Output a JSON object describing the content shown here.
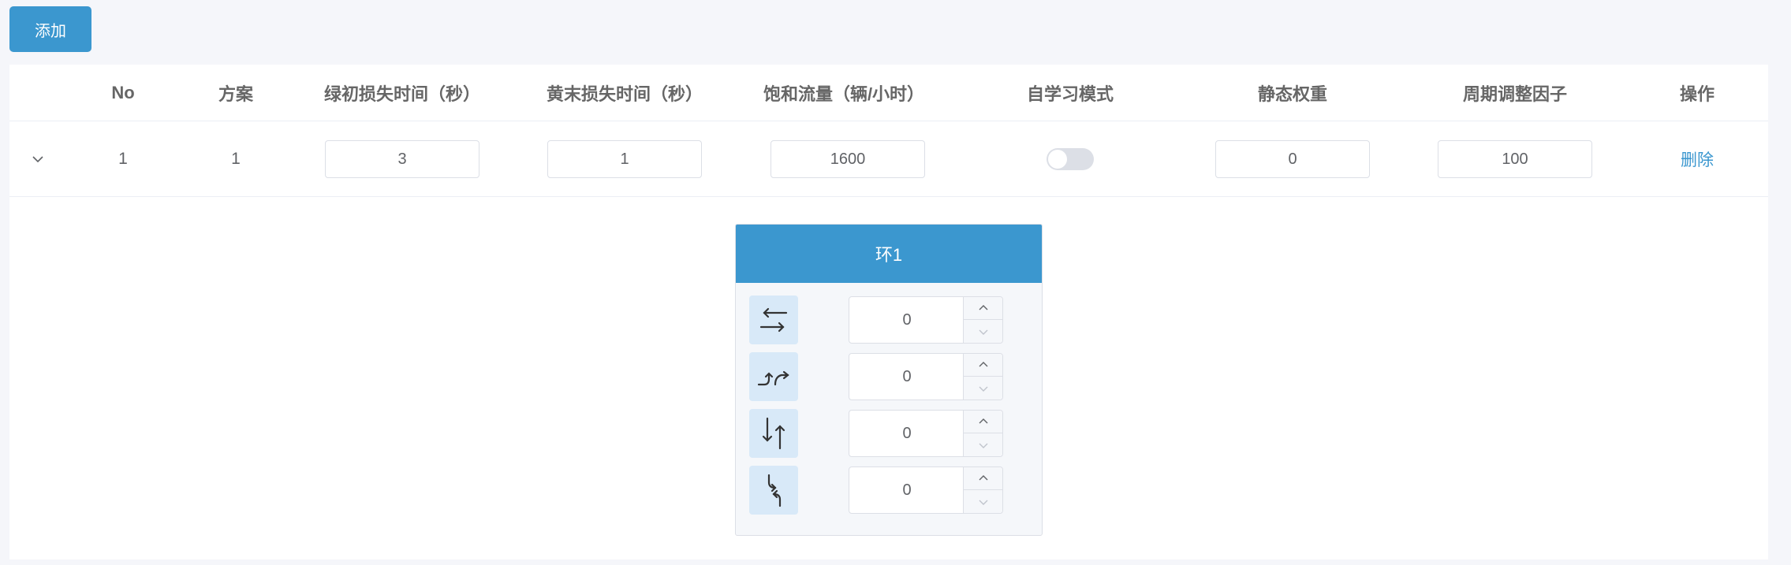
{
  "toolbar": {
    "add_label": "添加"
  },
  "table": {
    "headers": [
      "No",
      "方案",
      "绿初损失时间（秒）",
      "黄末损失时间（秒）",
      "饱和流量（辆/小时）",
      "自学习模式",
      "静态权重",
      "周期调整因子",
      "操作"
    ],
    "rows": [
      {
        "no": "1",
        "plan": "1",
        "green_loss": "3",
        "yellow_loss": "1",
        "saturation_flow": "1600",
        "self_learning": false,
        "static_weight": "0",
        "cycle_factor": "100",
        "action": "删除"
      }
    ]
  },
  "ring": {
    "title": "环1",
    "phases": [
      {
        "icon": "straight-through-icon",
        "value": "0"
      },
      {
        "icon": "left-turn-icon",
        "value": "0"
      },
      {
        "icon": "north-south-straight-icon",
        "value": "0"
      },
      {
        "icon": "north-south-left-turn-icon",
        "value": "0"
      }
    ]
  },
  "colors": {
    "primary": "#3b97cf",
    "icon_bg": "#d8e9f8"
  }
}
